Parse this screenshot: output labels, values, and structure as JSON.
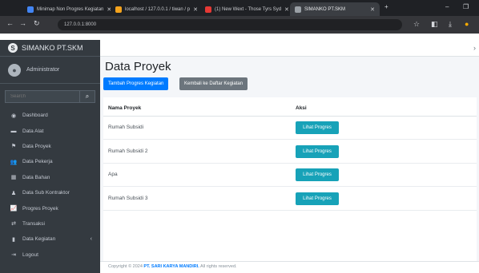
{
  "browser": {
    "tabs": [
      {
        "label": "Minimap Non Progres Kegiatan",
        "color": "#4285f4"
      },
      {
        "label": "localhost / 127.0.0.1 / tiwan / p",
        "color": "#f4a31d"
      },
      {
        "label": "(1) New Wext - Those Tyrs Syd",
        "color": "#e53935"
      },
      {
        "label": "SIMANKO PT.SKM",
        "color": "#9aa0a6"
      }
    ],
    "url": "127.0.0.1:8000"
  },
  "app": {
    "brand": "SIMANKO PT.SKM",
    "user": "Administrator",
    "search_placeholder": "Search"
  },
  "sidebar": {
    "items": [
      {
        "label": "Dashboard",
        "icon": "tachometer-icon",
        "glyph": "◉"
      },
      {
        "label": "Data Alat",
        "icon": "tools-icon",
        "glyph": "▬"
      },
      {
        "label": "Data Proyek",
        "icon": "project-icon",
        "glyph": "⚑"
      },
      {
        "label": "Data Pekerja",
        "icon": "users-icon",
        "glyph": "👥"
      },
      {
        "label": "Data Bahan",
        "icon": "cubes-icon",
        "glyph": "▦"
      },
      {
        "label": "Data Sub Kontraktor",
        "icon": "user-tie-icon",
        "glyph": "♟"
      },
      {
        "label": "Progres Proyek",
        "icon": "chart-line-icon",
        "glyph": "📈"
      },
      {
        "label": "Transaksi",
        "icon": "exchange-icon",
        "glyph": "⇄"
      },
      {
        "label": "Data Kegiatan",
        "icon": "book-icon",
        "glyph": "▮"
      },
      {
        "label": "Logout",
        "icon": "logout-icon",
        "glyph": "⇥"
      }
    ]
  },
  "main": {
    "title": "Data Proyek",
    "btn_add": "Tambah Progres Kegiatan",
    "btn_back": "Kembali ke Daftar Kegiatan",
    "columns": [
      "Nama Proyek",
      "Aksi"
    ],
    "rows": [
      {
        "name": "Rumah Subsidi",
        "action": "Lihat Progres"
      },
      {
        "name": "Rumah Subsidi 2",
        "action": "Lihat Progres"
      },
      {
        "name": "Apa",
        "action": "Lihat Progres"
      },
      {
        "name": "Rumah Subsidi 3",
        "action": "Lihat Progres"
      }
    ]
  },
  "footer": {
    "prefix": "Copyright © 2024 ",
    "company": "PT. SARI KARYA MANDIRI.",
    "suffix": " All rights reserved."
  }
}
